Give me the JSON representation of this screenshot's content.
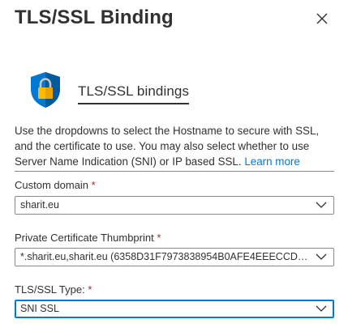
{
  "panel": {
    "title": "TLS/SSL Binding",
    "close_icon": "close-icon"
  },
  "section": {
    "icon": "shield-lock-icon",
    "title": "TLS/SSL bindings",
    "description": "Use the dropdowns to select the Hostname to secure with SSL, and the certificate to use. You may also select whether to use Server Name Indication (SNI) or IP based SSL.",
    "learn_more": "Learn more"
  },
  "fields": {
    "custom_domain": {
      "label": "Custom domain",
      "required_mark": "*",
      "value": "sharit.eu"
    },
    "thumbprint": {
      "label": "Private Certificate Thumbprint",
      "required_mark": "*",
      "value": "*.sharit.eu,sharit.eu (6358D31F7973838954B0AFE4EEECCDD..."
    },
    "ssl_type": {
      "label": "TLS/SSL Type:",
      "required_mark": "*",
      "value": "SNI SSL"
    }
  },
  "colors": {
    "accent": "#0078d4",
    "required": "#a4262c",
    "shield": "#0078d4",
    "lock": "#ffb900"
  }
}
